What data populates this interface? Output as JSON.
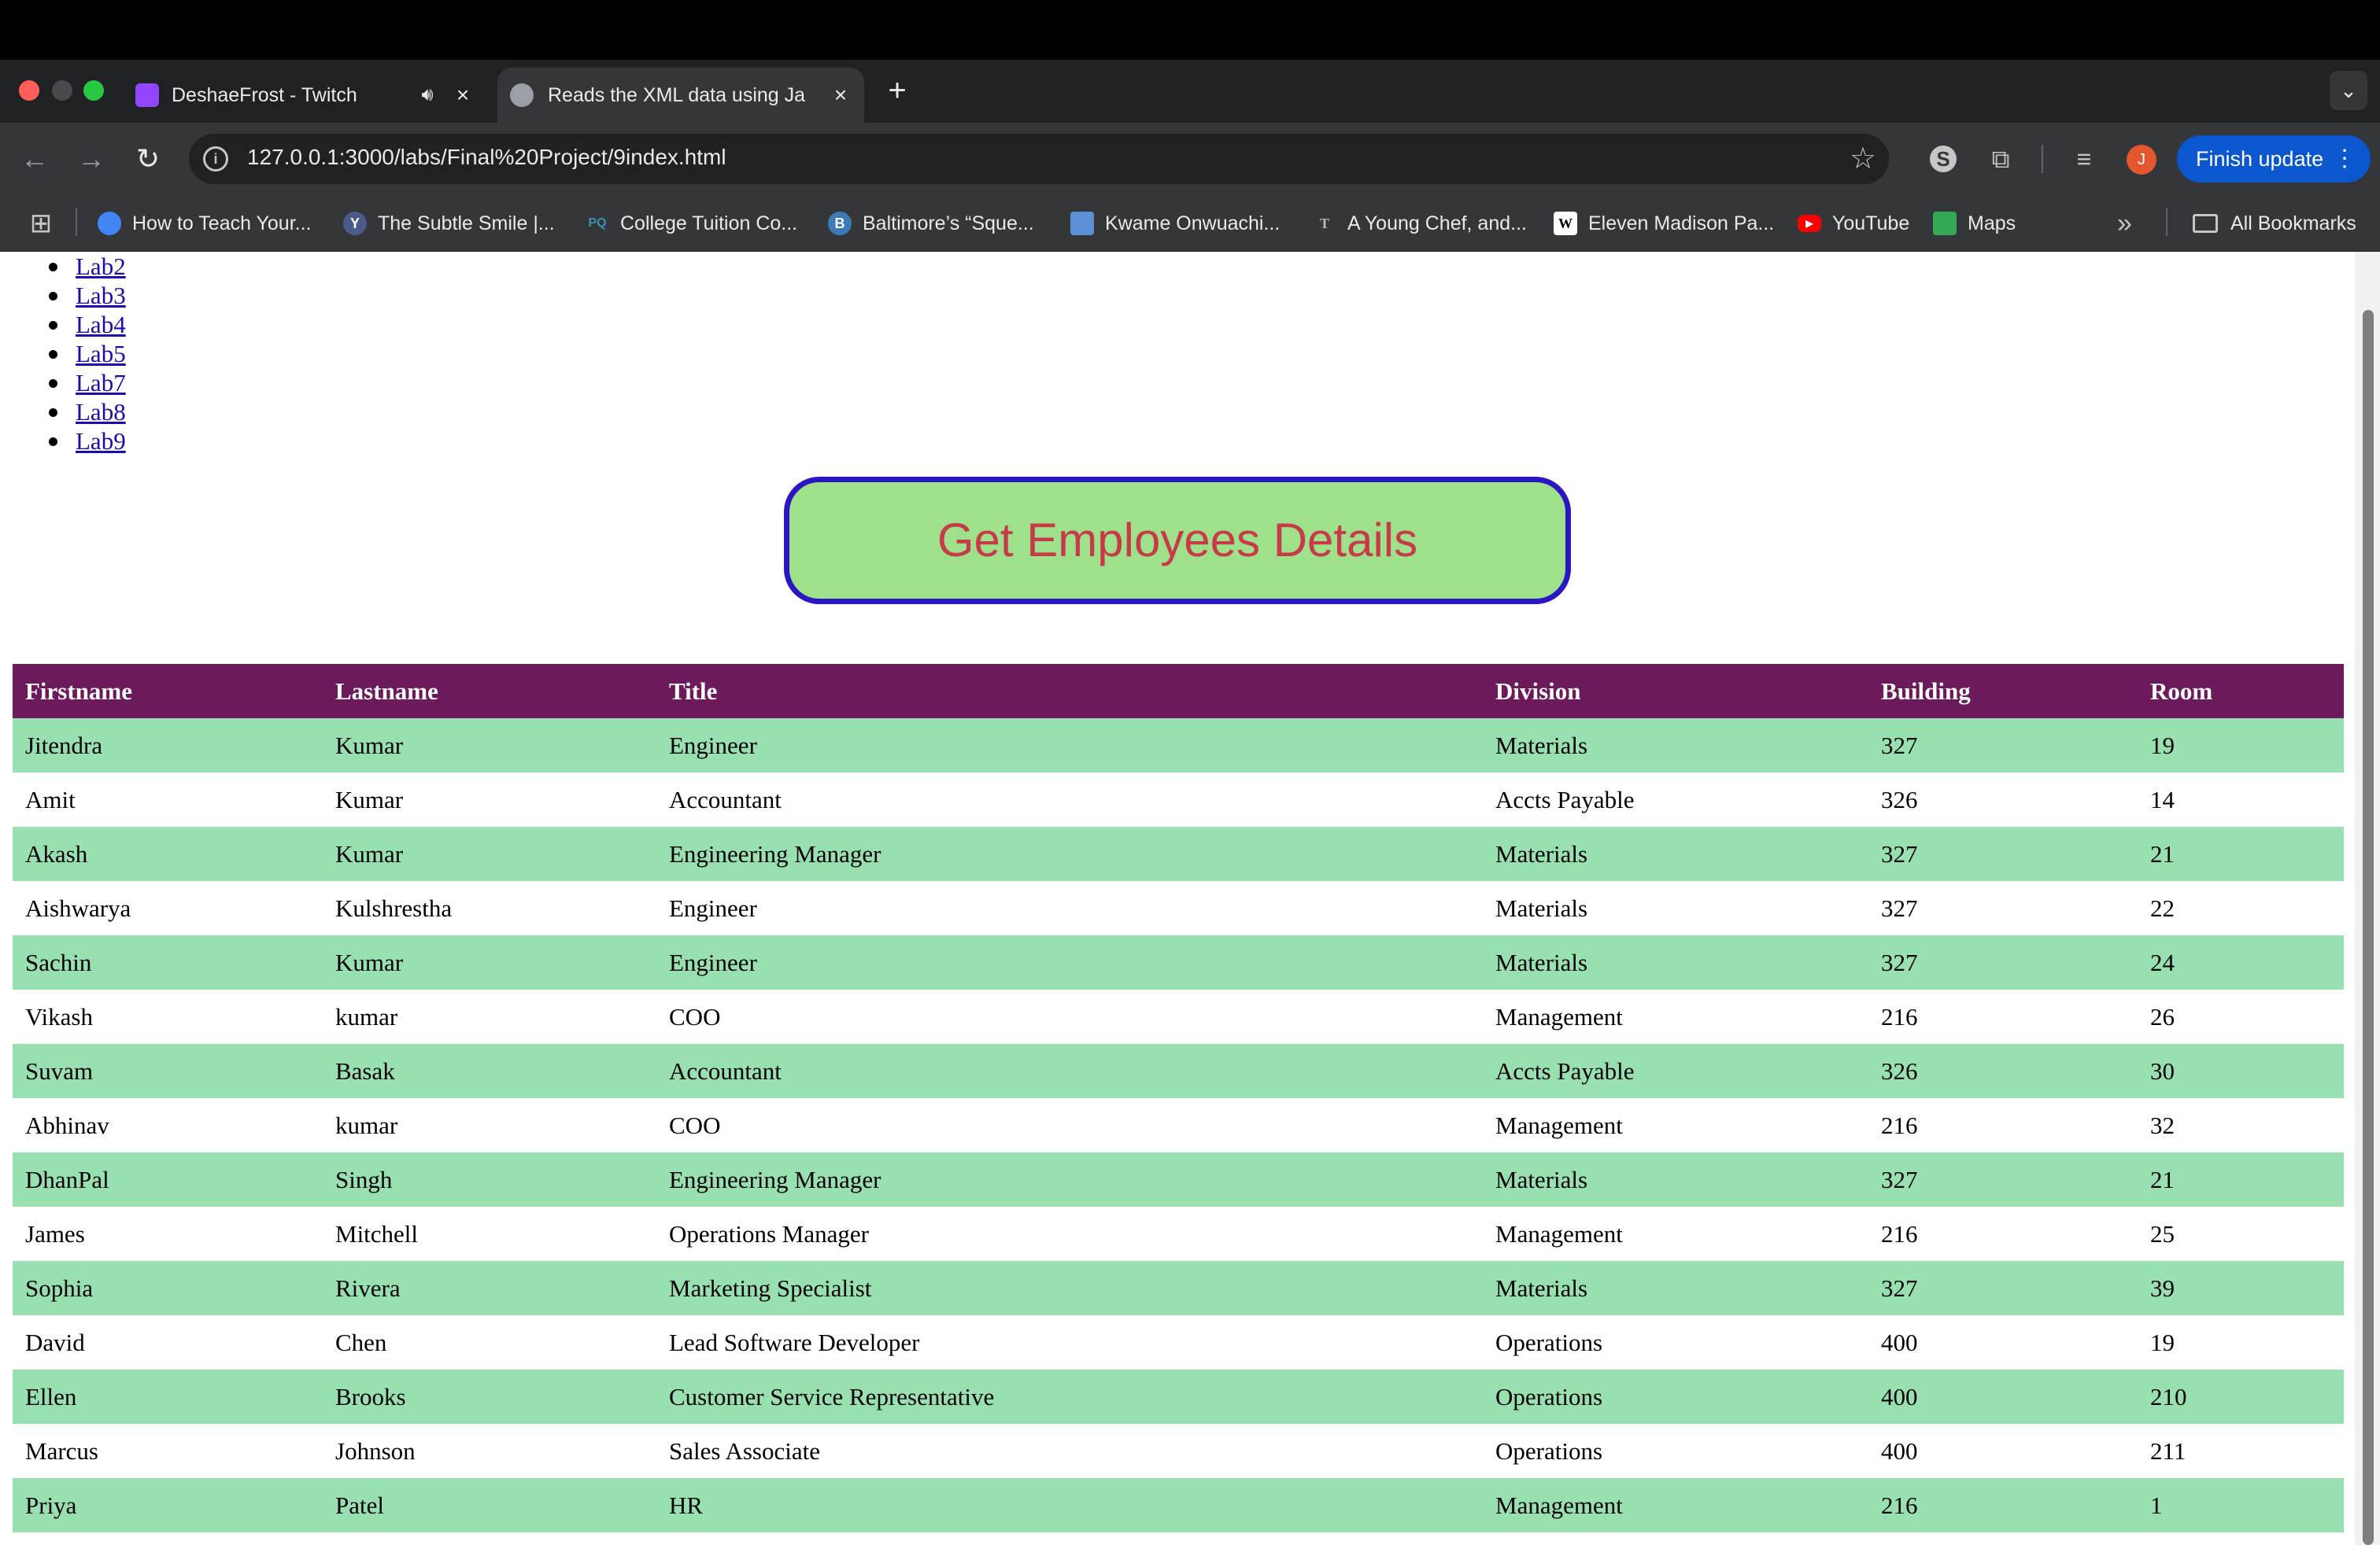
{
  "browser": {
    "tabs": [
      {
        "title": "DeshaeFrost - Twitch",
        "favicon": "twitch-icon",
        "audio_icon": "speaker-icon",
        "close": "×"
      },
      {
        "title": "Reads the XML data using Ja",
        "favicon": "globe-icon",
        "close": "×",
        "active": true
      }
    ],
    "new_tab": "+",
    "tab_search_icon": "⌄",
    "url": "127.0.0.1:3000/labs/Final%20Project/9index.html",
    "finish_update_label": "Finish update",
    "avatar_letter": "J",
    "accent_color": "#0b57d0"
  },
  "bookmarks": [
    {
      "label": "How to Teach Your...",
      "icon": "globe-blue-icon"
    },
    {
      "label": "The Subtle Smile |...",
      "icon": "yale-icon"
    },
    {
      "label": "College Tuition Co...",
      "icon": "pq-icon"
    },
    {
      "label": "Baltimore’s “Sque...",
      "icon": "b-circle-icon"
    },
    {
      "label": "Kwame Onwuachi...",
      "icon": "laptop-icon"
    },
    {
      "label": "A Young Chef, and...",
      "icon": "nyt-icon"
    },
    {
      "label": "Eleven Madison Pa...",
      "icon": "wikipedia-icon"
    },
    {
      "label": "YouTube",
      "icon": "youtube-icon"
    },
    {
      "label": "Maps",
      "icon": "maps-icon"
    }
  ],
  "all_bookmarks_label": "All Bookmarks",
  "labs": [
    "Lab2",
    "Lab3",
    "Lab4",
    "Lab5",
    "Lab7",
    "Lab8",
    "Lab9"
  ],
  "get_button_label": "Get Employees Details",
  "table": {
    "headers": [
      "Firstname",
      "Lastname",
      "Title",
      "Division",
      "Building",
      "Room"
    ],
    "rows": [
      [
        "Jitendra",
        "Kumar",
        "Engineer",
        "Materials",
        "327",
        "19"
      ],
      [
        "Amit",
        "Kumar",
        "Accountant",
        "Accts Payable",
        "326",
        "14"
      ],
      [
        "Akash",
        "Kumar",
        "Engineering Manager",
        "Materials",
        "327",
        "21"
      ],
      [
        "Aishwarya",
        "Kulshrestha",
        "Engineer",
        "Materials",
        "327",
        "22"
      ],
      [
        "Sachin",
        "Kumar",
        "Engineer",
        "Materials",
        "327",
        "24"
      ],
      [
        "Vikash",
        "kumar",
        "COO",
        "Management",
        "216",
        "26"
      ],
      [
        "Suvam",
        "Basak",
        "Accountant",
        "Accts Payable",
        "326",
        "30"
      ],
      [
        "Abhinav",
        "kumar",
        "COO",
        "Management",
        "216",
        "32"
      ],
      [
        "DhanPal",
        "Singh",
        "Engineering Manager",
        "Materials",
        "327",
        "21"
      ],
      [
        "James",
        "Mitchell",
        "Operations Manager",
        "Management",
        "216",
        "25"
      ],
      [
        "Sophia",
        "Rivera",
        "Marketing Specialist",
        "Materials",
        "327",
        "39"
      ],
      [
        "David",
        "Chen",
        "Lead Software Developer",
        "Operations",
        "400",
        "19"
      ],
      [
        "Ellen",
        "Brooks",
        "Customer Service Representative",
        "Operations",
        "400",
        "210"
      ],
      [
        "Marcus",
        "Johnson",
        "Sales Associate",
        "Operations",
        "400",
        "211"
      ],
      [
        "Priya",
        "Patel",
        "HR",
        "Management",
        "216",
        "1"
      ]
    ]
  },
  "colors": {
    "header_row": "#6d1a5d",
    "odd_row": "#98e0b0",
    "button_fill": "#9fe08a",
    "button_border": "#2b16c4",
    "button_text": "#c73a4a",
    "link": "#1a0dab"
  }
}
